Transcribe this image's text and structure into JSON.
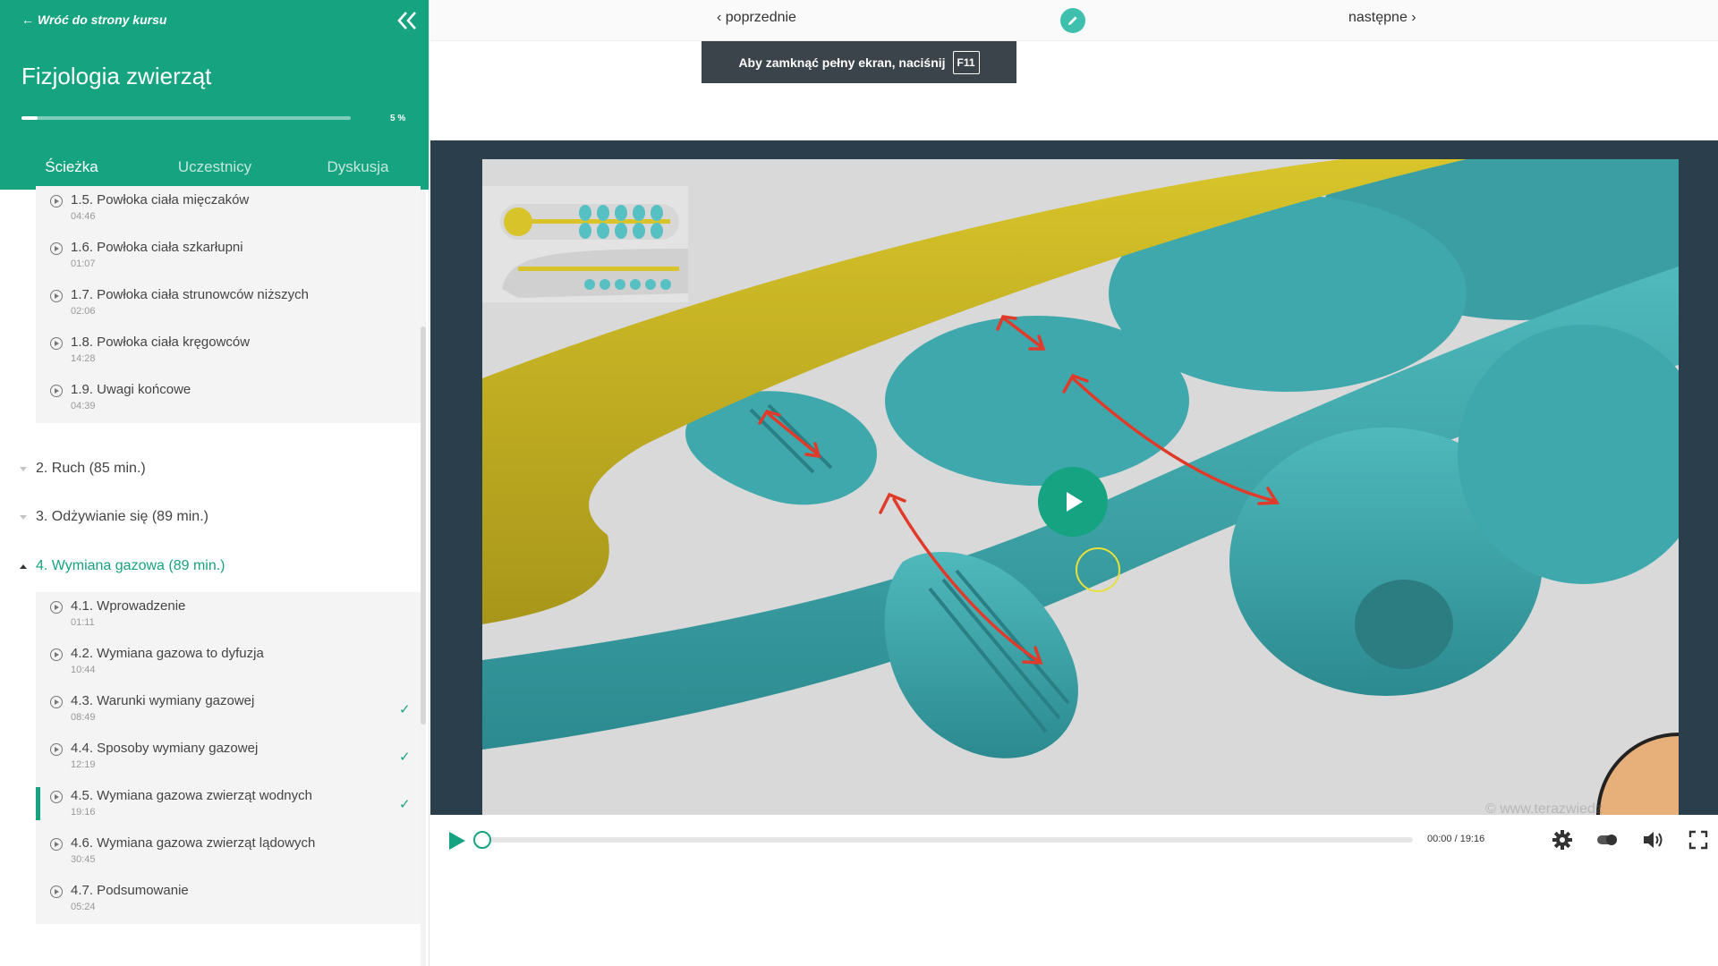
{
  "sidebar": {
    "back_label": "Wróć do strony kursu",
    "course_title": "Fizjologia zwierząt",
    "progress_percent": 5,
    "progress_label": "5 %",
    "tabs": [
      {
        "label": "Ścieżka",
        "active": true
      },
      {
        "label": "Uczestnicy",
        "active": false
      },
      {
        "label": "Dyskusja",
        "active": false
      }
    ],
    "section1_lessons": [
      {
        "title": "1.5. Powłoka ciała mięczaków",
        "time": "04:46"
      },
      {
        "title": "1.6. Powłoka ciała szkarłupni",
        "time": "01:07"
      },
      {
        "title": "1.7. Powłoka ciała strunowców niższych",
        "time": "02:06"
      },
      {
        "title": "1.8. Powłoka ciała kręgowców",
        "time": "14:28"
      },
      {
        "title": "1.9. Uwagi końcowe",
        "time": "04:39"
      }
    ],
    "sections": [
      {
        "label": "2. Ruch (85 min.)",
        "open": false
      },
      {
        "label": "3. Odżywianie się (89 min.)",
        "open": false
      },
      {
        "label": "4. Wymiana gazowa (89 min.)",
        "open": true
      }
    ],
    "section4_lessons": [
      {
        "title": "4.1. Wprowadzenie",
        "time": "01:11",
        "done": false,
        "current": false
      },
      {
        "title": "4.2. Wymiana gazowa to dyfuzja",
        "time": "10:44",
        "done": false,
        "current": false
      },
      {
        "title": "4.3. Warunki wymiany gazowej",
        "time": "08:49",
        "done": true,
        "current": false
      },
      {
        "title": "4.4. Sposoby wymiany gazowej",
        "time": "12:19",
        "done": true,
        "current": false
      },
      {
        "title": "4.5. Wymiana gazowa zwierząt wodnych",
        "time": "19:16",
        "done": true,
        "current": true
      },
      {
        "title": "4.6. Wymiana gazowa zwierząt lądowych",
        "time": "30:45",
        "done": false,
        "current": false
      },
      {
        "title": "4.7. Podsumowanie",
        "time": "05:24",
        "done": false,
        "current": false
      }
    ]
  },
  "nav": {
    "prev_label": "‹ poprzednie",
    "next_label": "następne ›",
    "fullscreen_hint": "Aby zamknąć pełny ekran, naciśnij",
    "fullscreen_key": "F11"
  },
  "video": {
    "watermark": "© www.terazwiedz",
    "time_current": "00:00",
    "time_total": "19:16",
    "time_label": "00:00 / 19:16",
    "progress_fraction": 0
  },
  "colors": {
    "accent": "#16a37f",
    "video_frame": "#2b3e4c",
    "arrow_red": "#e03a2a",
    "organ_teal": "#3aa6a9",
    "organ_yellow": "#c9b31c"
  },
  "icons": {
    "back": "arrow-left-icon",
    "collapse": "double-chevron-left-icon",
    "edit": "pencil-icon",
    "play": "play-icon",
    "settings": "gear-icon",
    "toggle": "toggle-icon",
    "volume": "volume-icon",
    "fullscreen": "fullscreen-icon"
  }
}
